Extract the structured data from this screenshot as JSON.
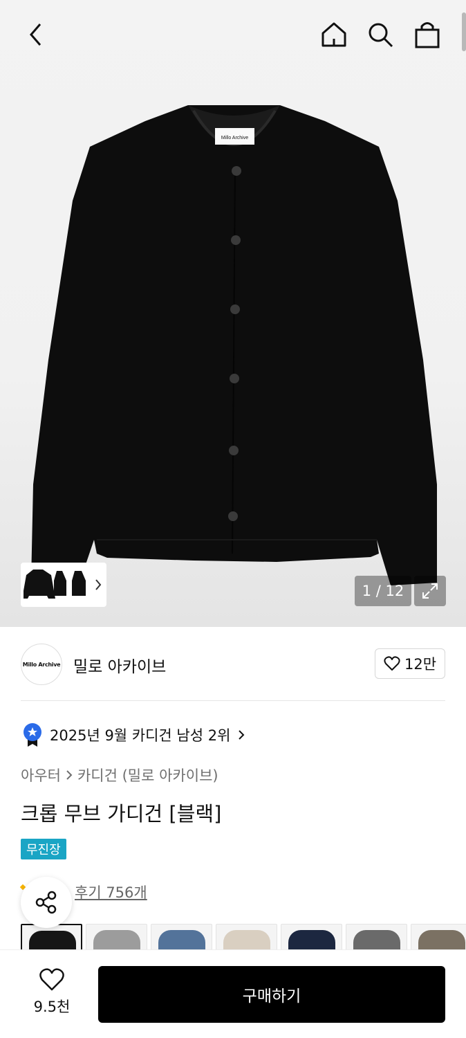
{
  "header": {
    "back_icon": "chevron-left-icon",
    "home_icon": "home-icon",
    "search_icon": "search-icon",
    "cart_icon": "shopping-bag-icon"
  },
  "gallery": {
    "counter": "1 / 12",
    "garment_label": "Millo Archive",
    "expand_icon": "expand-icon"
  },
  "brand": {
    "logo_text": "Millo Archive",
    "name": "밀로 아카이브",
    "likes": "12만"
  },
  "ranking": {
    "text": "2025년 9월 카디건 남성 2위",
    "icon": "ranking-badge-icon"
  },
  "breadcrumb": {
    "category": "아우터",
    "subcategory": "카디건 (밀로 아카이브)"
  },
  "product": {
    "title": "크롭 무브 가디건 [블랙]",
    "badge": "무진장",
    "reviews": "후기 756개"
  },
  "colors": [
    "#161616",
    "#9c9c9c",
    "#53739a",
    "#d9cfc1",
    "#1c2740",
    "#6a6a6a",
    "#7b7163"
  ],
  "bottom": {
    "wish_count": "9.5천",
    "buy_label": "구매하기"
  }
}
